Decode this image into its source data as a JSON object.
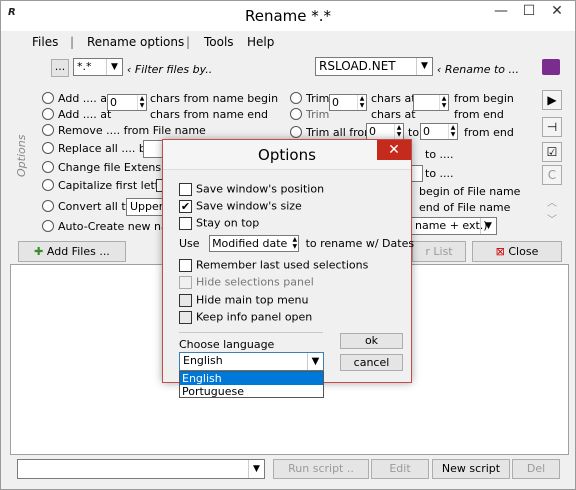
{
  "window": {
    "title": "Rename  *.*",
    "minimize": "—",
    "maximize": "☐",
    "close": "✕"
  },
  "menu": [
    "Files",
    "|",
    "Rename options",
    "|",
    "Tools",
    "Help"
  ],
  "filter": {
    "browse_label": "...",
    "mask_value": "*.*",
    "hint": "‹ Filter files by..",
    "rename_value": "RSLOAD.NET",
    "rename_hint": "‹ Rename to ..."
  },
  "options_label": "Options",
  "left_options": [
    {
      "label": "Add .... at",
      "value": "0",
      "suffix": "chars from name begin"
    },
    {
      "label": "Add .... at",
      "value": "0",
      "suffix": "chars from name end"
    },
    {
      "label": "Remove .... from File name"
    },
    {
      "label": "Replace all .... by"
    },
    {
      "label": "Change file Extension"
    },
    {
      "label": "Capitalize first letter"
    },
    {
      "label": "Convert all to",
      "value": "Upper"
    },
    {
      "label": "Auto-Create new name"
    }
  ],
  "right_options": [
    {
      "label": "Trim",
      "value": "0",
      "mid": "chars at",
      "suffix": "from begin"
    },
    {
      "label": "Trim",
      "value": "0",
      "mid": "chars at",
      "suffix": "from  end"
    },
    {
      "label": "Trim all from",
      "from": "0",
      "to_label": "to",
      "to": "0",
      "suffix": "from end"
    },
    {
      "label": "to ...."
    },
    {
      "label": "to ...."
    },
    {
      "label": "begin of File name"
    },
    {
      "label": "end of File name"
    },
    {
      "label": "name + ext.)"
    }
  ],
  "toolbar": {
    "add_files": "Add Files ...",
    "clear_list": "r List",
    "close": "Close"
  },
  "side_icons": [
    "book-icon",
    "play-icon",
    "pin-icon",
    "check-icon",
    "c-icon",
    "up-icon",
    "down-icon"
  ],
  "bottom": {
    "run_script": "Run script ..",
    "edit": "Edit",
    "new_script": "New script",
    "del": "Del"
  },
  "dialog": {
    "title": "Options",
    "close": "✕",
    "checks": [
      {
        "label": "Save window's position",
        "checked": false
      },
      {
        "label": "Save window's size",
        "checked": true
      },
      {
        "label": "Stay on top",
        "checked": false
      }
    ],
    "use_label": "Use",
    "date_value": "Modified date",
    "date_suffix": "to rename w/ Dates",
    "checks2": [
      {
        "label": "Remember last used selections",
        "checked": false,
        "disabled": false
      },
      {
        "label": "Hide selections panel",
        "checked": false,
        "disabled": true
      },
      {
        "label": "Hide main top menu",
        "checked": false,
        "disabled": false
      },
      {
        "label": "Keep info panel open",
        "checked": false,
        "disabled": false
      }
    ],
    "ok": "ok",
    "cancel": "cancel",
    "language_label": "Choose language",
    "language_value": "English",
    "language_options": [
      "English",
      "Portuguese"
    ]
  }
}
